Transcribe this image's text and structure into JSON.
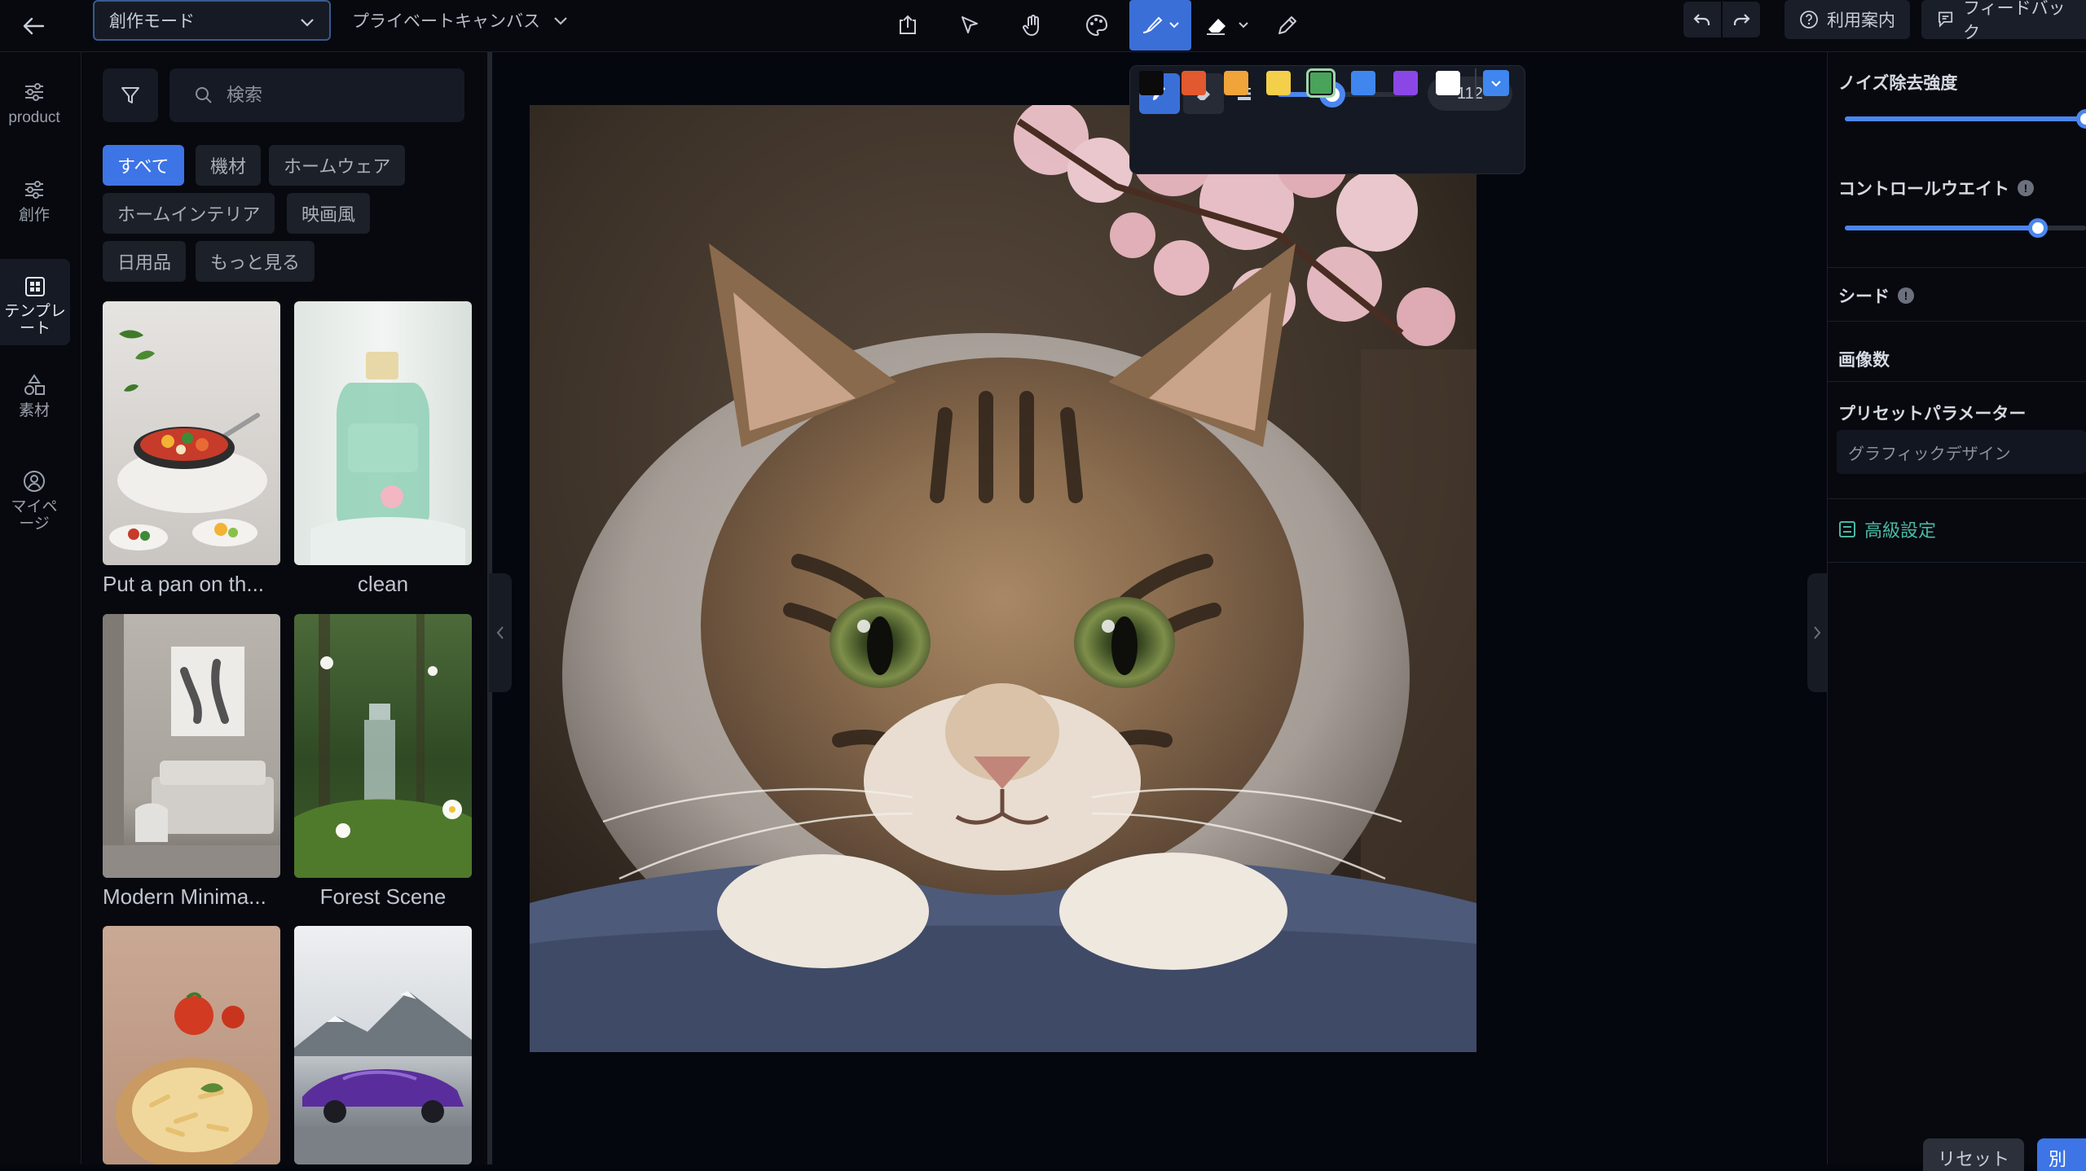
{
  "topbar": {
    "mode_select": "創作モード",
    "canvas_select": "プライベートキャンバス",
    "help_label": "利用案内",
    "feedback_label": "フィードバック"
  },
  "rail": {
    "items": [
      {
        "label": "product",
        "icon": "sliders-icon"
      },
      {
        "label": "創作",
        "icon": "sliders-icon"
      },
      {
        "label": "テンプレート",
        "icon": "template-icon"
      },
      {
        "label": "素材",
        "icon": "shapes-icon"
      },
      {
        "label": "マイページ",
        "icon": "user-icon"
      }
    ],
    "active_index": 2
  },
  "panel": {
    "search_placeholder": "検索",
    "chips": [
      "すべて",
      "機材",
      "ホームウェア",
      "ホームインテリア",
      "映画風",
      "日用品",
      "もっと見る"
    ],
    "active_chip": 0,
    "cards": [
      {
        "label": "Put a pan on th..."
      },
      {
        "label": "clean"
      },
      {
        "label": "Modern Minima..."
      },
      {
        "label": "Forest Scene"
      },
      {
        "label": ""
      },
      {
        "label": ""
      }
    ]
  },
  "brush": {
    "size": "112",
    "size_fraction": 0.4,
    "colors": [
      "#0b0b0b",
      "#e2582f",
      "#f0a43a",
      "#f3cf4a",
      "#4aa35a",
      "#3f86ee",
      "#8a47e6",
      "#ffffff"
    ],
    "selected_color": 4
  },
  "right": {
    "noise_label": "ノイズ除去強度",
    "noise_value": 1.0,
    "control_label": "コントロールウエイト",
    "control_value": 0.8,
    "seed_label": "シード",
    "count_label": "画像数",
    "preset_label": "プリセットパラメーター",
    "preset_value": "グラフィックデザイン",
    "advanced_label": "高級設定",
    "reset_label": "リセット",
    "generate_label": "別"
  }
}
